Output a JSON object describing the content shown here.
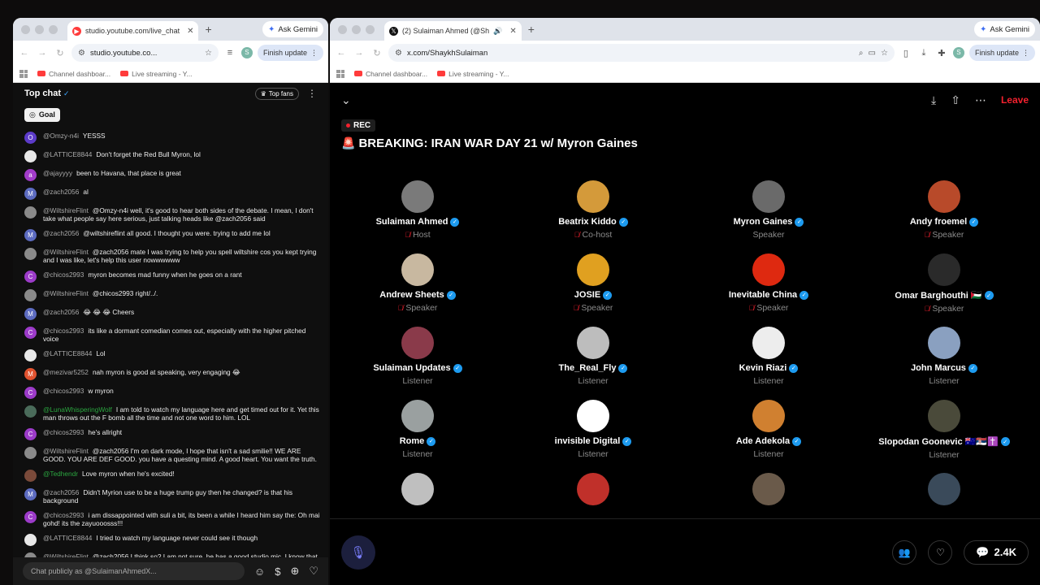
{
  "left_window": {
    "tab_title": "studio.youtube.com/live_chat",
    "ask_gemini": "Ask Gemini",
    "address": "studio.youtube.co...",
    "finish_update": "Finish update",
    "bookmarks": [
      "Channel dashboar...",
      "Live streaming - Y..."
    ],
    "chat": {
      "title": "Top chat",
      "top_fans": "Top fans",
      "goal": "Goal",
      "input_placeholder": "Chat publicly as @SulaimanAhmedX...",
      "messages": [
        {
          "author": "@Omzy-n4i",
          "text": "YESSS",
          "av": "O",
          "color": "#5c3bc9",
          "green": false
        },
        {
          "author": "@LATTICE8844",
          "text": "Don't forget the Red Bull Myron, lol",
          "av": "",
          "color": "#e8e8e8",
          "green": false
        },
        {
          "author": "@ajayyyy",
          "text": "been to Havana, that place is great",
          "av": "a",
          "color": "#a23cc9",
          "green": false
        },
        {
          "author": "@zach2056",
          "text": "al",
          "av": "M",
          "color": "#5c6bc0",
          "green": false
        },
        {
          "author": "@WiltshireFlint",
          "text": "@Omzy-n4i well, it's good to hear both sides of the debate. I mean, I don't take what people say here serious, just talking heads like @zach2056 said",
          "av": "",
          "color": "#8a8a8a",
          "green": false
        },
        {
          "author": "@zach2056",
          "text": "@wiltshireflint all good. I thought you were. trying to add me lol",
          "av": "M",
          "color": "#5c6bc0",
          "green": false
        },
        {
          "author": "@WiltshireFlint",
          "text": "@zach2056 mate I was trying to help you spell wiltshire cos you kept trying and I was like, let's help this user nowwwwww",
          "av": "",
          "color": "#8a8a8a",
          "green": false
        },
        {
          "author": "@chicos2993",
          "text": "myron becomes mad funny when he goes on a rant",
          "av": "C",
          "color": "#9c3bc9",
          "green": false
        },
        {
          "author": "@WiltshireFlint",
          "text": "@chicos2993 right/../.",
          "av": "",
          "color": "#8a8a8a",
          "green": false
        },
        {
          "author": "@zach2056",
          "text": "😂 😂 😂 Cheers",
          "av": "M",
          "color": "#5c6bc0",
          "green": false
        },
        {
          "author": "@chicos2993",
          "text": "its like a dormant comedian comes out, especially with the higher pitched voice",
          "av": "C",
          "color": "#9c3bc9",
          "green": false
        },
        {
          "author": "@LATTICE8844",
          "text": "Lol",
          "av": "",
          "color": "#e8e8e8",
          "green": false
        },
        {
          "author": "@mezivar5252",
          "text": "nah myron is good at speaking, very engaging 😂",
          "av": "M",
          "color": "#e0522f",
          "green": false
        },
        {
          "author": "@chicos2993",
          "text": "w myron",
          "av": "C",
          "color": "#9c3bc9",
          "green": false
        },
        {
          "author": "@LunaWhisperingWolf",
          "text": "I am told to watch my language here and get timed out for it. Yet this man throws out the F bomb all the time and not one word to him. LOL",
          "av": "",
          "color": "#4a6b5a",
          "green": true
        },
        {
          "author": "@chicos2993",
          "text": "he's allright",
          "av": "C",
          "color": "#9c3bc9",
          "green": false
        },
        {
          "author": "@WiltshireFlint",
          "text": "@zach2056 I'm on dark mode, I hope that isn't a sad smilie!! WE ARE GOOD. YOU ARE DEF GOOD. you have a questing mind. A good heart. You want the truth.",
          "av": "",
          "color": "#8a8a8a",
          "green": false
        },
        {
          "author": "@Tedhendr",
          "text": "Love myron when he's excited!",
          "av": "",
          "color": "#7a4a3a",
          "green": true
        },
        {
          "author": "@zach2056",
          "text": "Didn't Myrion use to be a huge trump guy then he changed? is that his background",
          "av": "M",
          "color": "#5c6bc0",
          "green": false
        },
        {
          "author": "@chicos2993",
          "text": "i am dissappointed with suli a bit, its been a while I heard him say the: Oh mai gohd! its the zayuooosss!!!",
          "av": "C",
          "color": "#9c3bc9",
          "green": false
        },
        {
          "author": "@LATTICE8844",
          "text": "I tried to watch my language never could see it though",
          "av": "",
          "color": "#e8e8e8",
          "green": false
        },
        {
          "author": "@WiltshireFlint",
          "text": "@zach2056 I think so? I am not sure, he has a good studio mic, I know that much.",
          "av": "",
          "color": "#8a8a8a",
          "green": false
        }
      ]
    }
  },
  "right_window": {
    "tab_title": "(2) Sulaiman Ahmed (@Sh",
    "ask_gemini": "Ask Gemini",
    "address": "x.com/ShaykhSulaiman",
    "finish_update": "Finish update",
    "bookmarks": [
      "Channel dashboar...",
      "Live streaming - Y..."
    ],
    "space": {
      "rec": "REC",
      "title": "BREAKING: IRAN WAR DAY 21 w/ Myron Gaines",
      "leave": "Leave",
      "count": "2.4K",
      "participants": [
        {
          "name": "Sulaiman Ahmed",
          "role": "Host",
          "bg": "#7a7a7a",
          "verified": true,
          "muted": true
        },
        {
          "name": "Beatrix Kiddo",
          "role": "Co-host",
          "bg": "#d49a3a",
          "verified": true,
          "muted": true
        },
        {
          "name": "Myron Gaines",
          "role": "Speaker",
          "bg": "#6a6a6a",
          "verified": true,
          "muted": false
        },
        {
          "name": "Andy froemel",
          "role": "Speaker",
          "bg": "#b84a2a",
          "verified": true,
          "muted": true
        },
        {
          "name": "Andrew Sheets",
          "role": "Speaker",
          "bg": "#c8b8a0",
          "verified": true,
          "muted": true
        },
        {
          "name": "JOSIE",
          "role": "Speaker",
          "bg": "#e0a020",
          "verified": true,
          "muted": true
        },
        {
          "name": "Inevitable China",
          "role": "Speaker",
          "bg": "#de2910",
          "verified": true,
          "muted": true
        },
        {
          "name": "Omar Barghouthi 🇵🇸",
          "role": "Speaker",
          "bg": "#2a2a2a",
          "verified": true,
          "muted": true
        },
        {
          "name": "Sulaiman Updates",
          "role": "Listener",
          "bg": "#8a3a4a",
          "verified": true,
          "muted": false
        },
        {
          "name": "The_Real_Fly",
          "role": "Listener",
          "bg": "#bdbdbd",
          "verified": true,
          "muted": false
        },
        {
          "name": "Kevin Riazi",
          "role": "Listener",
          "bg": "#ededed",
          "verified": true,
          "muted": false
        },
        {
          "name": "John Marcus",
          "role": "Listener",
          "bg": "#8aa0c0",
          "verified": true,
          "muted": false
        },
        {
          "name": "Rome",
          "role": "Listener",
          "bg": "#9aa0a0",
          "verified": true,
          "muted": false
        },
        {
          "name": "invisible Digital",
          "role": "Listener",
          "bg": "#ffffff",
          "verified": true,
          "muted": false
        },
        {
          "name": "Ade Adekola",
          "role": "Listener",
          "bg": "#d08030",
          "verified": true,
          "muted": false
        },
        {
          "name": "Slopodan Goonevic 🇦🇺🇷🇸✝️",
          "role": "Listener",
          "bg": "#4a4a3a",
          "verified": true,
          "muted": false
        },
        {
          "name": "",
          "role": "",
          "bg": "#bfbfbf",
          "verified": false,
          "muted": false
        },
        {
          "name": "",
          "role": "",
          "bg": "#c0302a",
          "verified": false,
          "muted": false
        },
        {
          "name": "",
          "role": "",
          "bg": "#6a5a4a",
          "verified": false,
          "muted": false
        },
        {
          "name": "",
          "role": "",
          "bg": "#3a4a5a",
          "verified": false,
          "muted": false
        }
      ]
    }
  }
}
